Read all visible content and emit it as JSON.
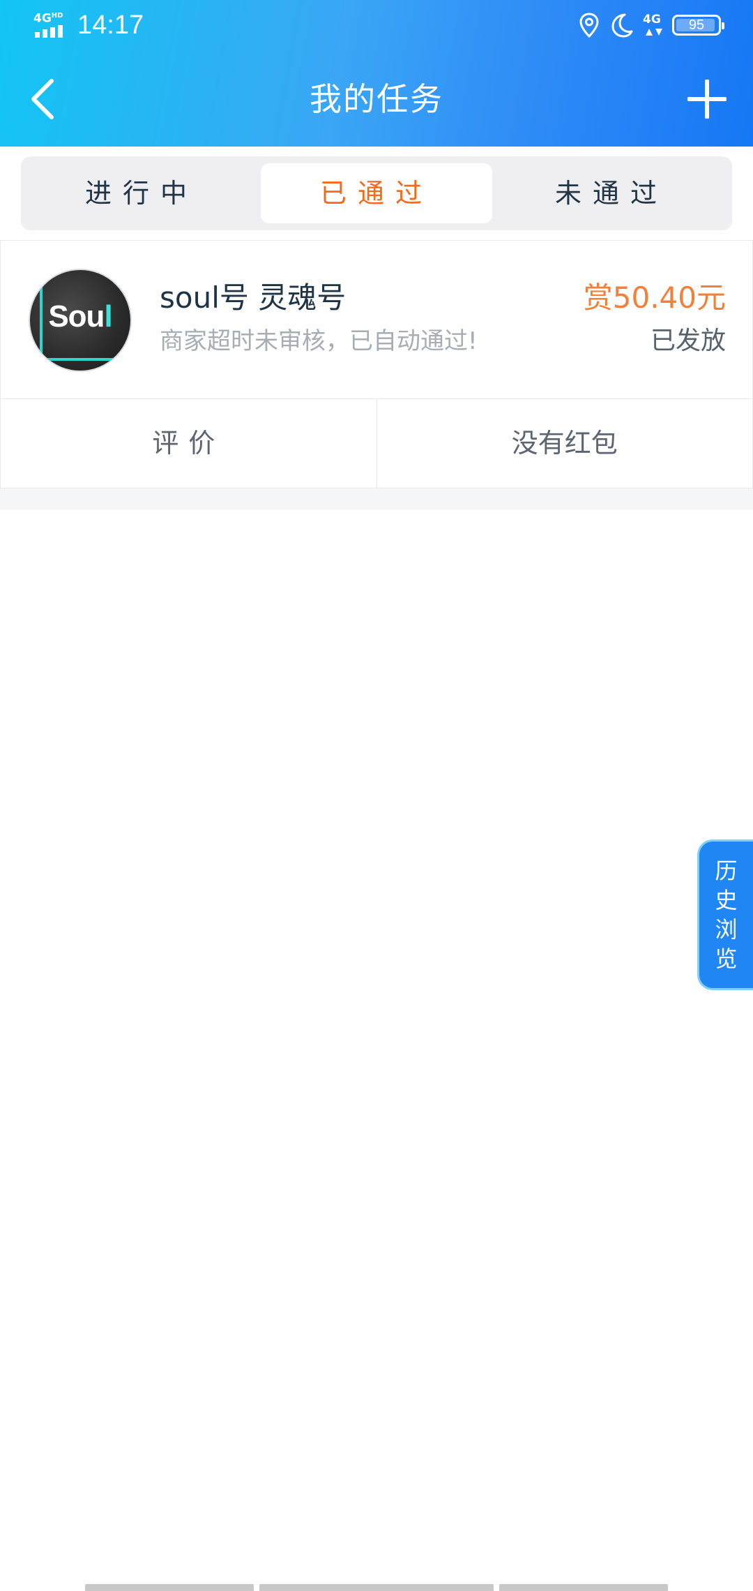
{
  "status_bar": {
    "network": "4G",
    "network_sup": "HD",
    "time": "14:17",
    "network_right": "4G",
    "battery": "95"
  },
  "header": {
    "title": "我的任务",
    "back_icon": "chevron-left-icon",
    "add_icon": "plus-icon"
  },
  "tabs": [
    {
      "label": "进行中",
      "active": false
    },
    {
      "label": "已通过",
      "active": true
    },
    {
      "label": "未通过",
      "active": false
    }
  ],
  "task": {
    "logo_text_a": "Sou",
    "logo_text_b": "l",
    "title": "soul号 灵魂号",
    "status_text": "商家超时未审核，已自动通过!",
    "reward": "赏50.40元",
    "issued": "已发放",
    "actions": {
      "review": "评价",
      "red_packet": "没有红包"
    }
  },
  "floating": {
    "history": "历史浏览"
  },
  "colors": {
    "accent": "#1f86f3",
    "active_tab": "#f36a1c",
    "reward": "#f0803a"
  }
}
